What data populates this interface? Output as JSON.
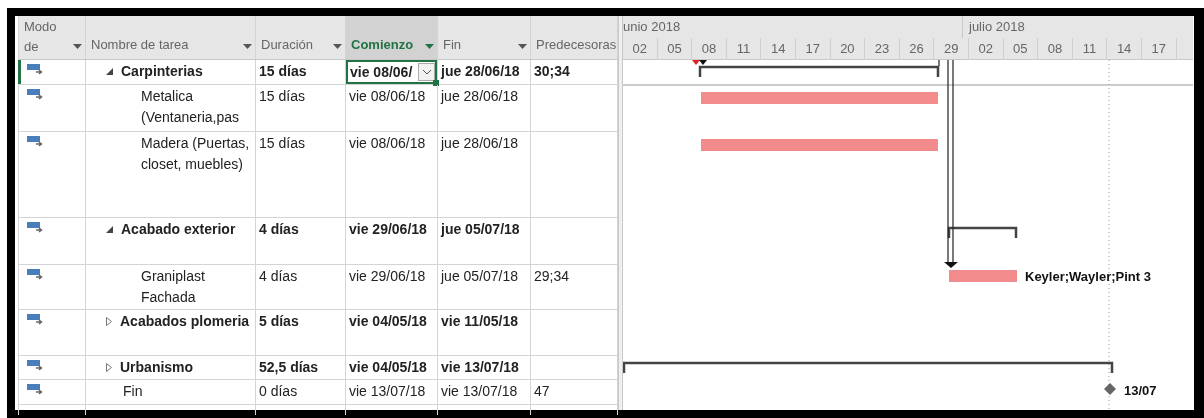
{
  "table": {
    "columns": [
      {
        "label": "Modo de",
        "selected": false,
        "menu": true
      },
      {
        "label": "Nombre de tarea",
        "selected": false,
        "menu": true
      },
      {
        "label": "Duración",
        "selected": false,
        "menu": true
      },
      {
        "label": "Comienzo",
        "selected": true,
        "menu": true
      },
      {
        "label": "Fin",
        "selected": false,
        "menu": true
      },
      {
        "label": "Predecesoras",
        "selected": false,
        "menu": false
      }
    ],
    "tasks": [
      {
        "kind": "summary",
        "name": "Carpinterias",
        "duration": "15 días",
        "start": "vie 08/06/",
        "end": "jue 28/06/18",
        "predecessors": "30;34",
        "expanded": true,
        "selected": true,
        "children": [
          {
            "kind": "task",
            "name": "Metalica (Ventaneria,pas",
            "duration": "15 días",
            "start": "vie 08/06/18",
            "end": "jue 28/06/18",
            "selected": false
          },
          {
            "kind": "task",
            "name": "Madera (Puertas, closet, muebles)",
            "duration": "15 días",
            "start": "vie 08/06/18",
            "end": "jue 28/06/18",
            "selected": false
          }
        ]
      },
      {
        "kind": "summary",
        "name": "Acabado exterior",
        "duration": "4 días",
        "start": "vie 29/06/18",
        "end": "jue 05/07/18",
        "expanded": true,
        "selected": false,
        "children": [
          {
            "kind": "task",
            "name": "Graniplast Fachada",
            "duration": "4 días",
            "start": "vie 29/06/18",
            "end": "jue 05/07/18",
            "predecessors": "29;34",
            "bar_label": "Keyler;Wayler;Pint 3",
            "selected": false
          }
        ]
      },
      {
        "kind": "summary",
        "name": "Acabados plomeria",
        "duration": "5 días",
        "start": "vie 04/05/18",
        "end": "vie 11/05/18",
        "expanded": false,
        "selected": false
      },
      {
        "kind": "summary",
        "name": "Urbanismo",
        "duration": "52,5 días",
        "start": "vie 04/05/18",
        "end": "vie 13/07/18",
        "expanded": false,
        "selected": false
      },
      {
        "kind": "milestone",
        "name": "Fin",
        "duration": "0 días",
        "start": "vie 13/07/18",
        "end": "vie 13/07/18",
        "predecessors": "47",
        "bar_label": "13/07",
        "selected": false
      }
    ]
  },
  "gantt": {
    "months": [
      "unio 2018",
      "julio 2018"
    ],
    "days": [
      "02",
      "05",
      "08",
      "11",
      "14",
      "17",
      "20",
      "23",
      "26",
      "29",
      "02",
      "05",
      "08",
      "11",
      "14",
      "17"
    ]
  }
}
